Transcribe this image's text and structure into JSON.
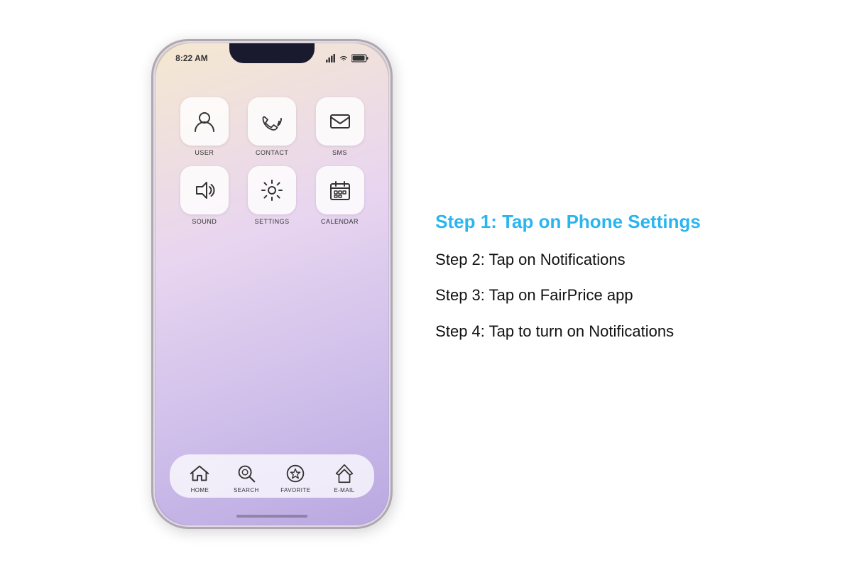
{
  "phone": {
    "status": {
      "time": "8:22 AM",
      "location_icon": "▲",
      "signal": "signal",
      "wifi": "wifi",
      "battery": "battery"
    },
    "apps": [
      {
        "id": "user",
        "label": "USER",
        "icon": "user"
      },
      {
        "id": "contact",
        "label": "CONTACT",
        "icon": "contact"
      },
      {
        "id": "sms",
        "label": "SMS",
        "icon": "sms"
      },
      {
        "id": "sound",
        "label": "SOUND",
        "icon": "sound"
      },
      {
        "id": "settings",
        "label": "SETTINGS",
        "icon": "settings"
      },
      {
        "id": "calendar",
        "label": "CALENDAR",
        "icon": "calendar"
      }
    ],
    "dock": [
      {
        "id": "home",
        "label": "HOME",
        "icon": "home"
      },
      {
        "id": "search",
        "label": "SEARCH",
        "icon": "search"
      },
      {
        "id": "favorite",
        "label": "FAVORITE",
        "icon": "favorite"
      },
      {
        "id": "email",
        "label": "E-MAIL",
        "icon": "email"
      }
    ]
  },
  "instructions": {
    "step1": "Step 1: Tap on Phone Settings",
    "step2": "Step 2: Tap on Notifications",
    "step3": "Step 3: Tap on FairPrice app",
    "step4": "Step 4: Tap to turn on Notifications"
  }
}
